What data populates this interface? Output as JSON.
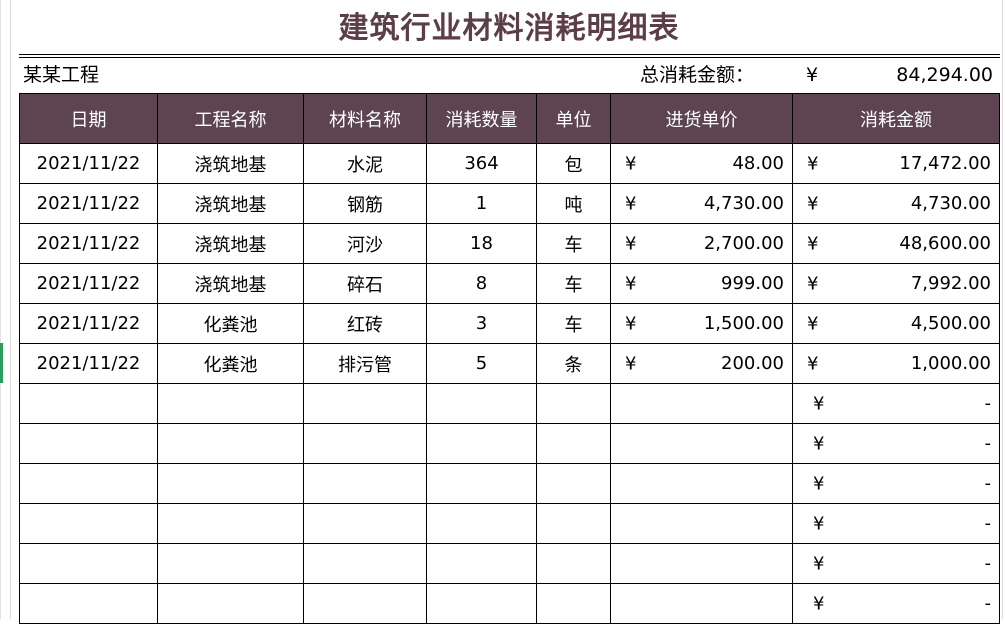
{
  "title": "建筑行业材料消耗明细表",
  "project_name": "某某工程",
  "total_label": "总消耗金额：",
  "currency": "¥",
  "total_value": "84,294.00",
  "headers": [
    "日期",
    "工程名称",
    "材料名称",
    "消耗数量",
    "单位",
    "进货单价",
    "消耗金额"
  ],
  "rows": [
    {
      "date": "2021/11/22",
      "project": "浇筑地基",
      "material": "水泥",
      "qty": "364",
      "unit": "包",
      "price": "48.00",
      "amount": "17,472.00"
    },
    {
      "date": "2021/11/22",
      "project": "浇筑地基",
      "material": "钢筋",
      "qty": "1",
      "unit": "吨",
      "price": "4,730.00",
      "amount": "4,730.00"
    },
    {
      "date": "2021/11/22",
      "project": "浇筑地基",
      "material": "河沙",
      "qty": "18",
      "unit": "车",
      "price": "2,700.00",
      "amount": "48,600.00"
    },
    {
      "date": "2021/11/22",
      "project": "浇筑地基",
      "material": "碎石",
      "qty": "8",
      "unit": "车",
      "price": "999.00",
      "amount": "7,992.00"
    },
    {
      "date": "2021/11/22",
      "project": "化粪池",
      "material": "红砖",
      "qty": "3",
      "unit": "车",
      "price": "1,500.00",
      "amount": "4,500.00"
    },
    {
      "date": "2021/11/22",
      "project": "化粪池",
      "material": "排污管",
      "qty": "5",
      "unit": "条",
      "price": "200.00",
      "amount": "1,000.00"
    }
  ],
  "empty_amount": "-",
  "empty_row_count": 6
}
